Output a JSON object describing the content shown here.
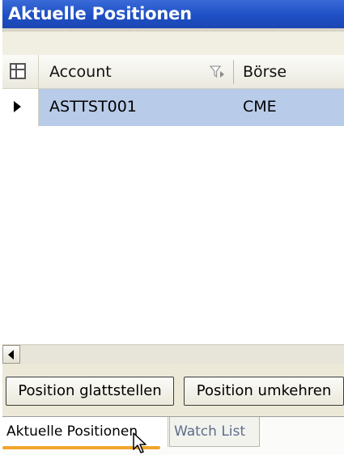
{
  "window": {
    "title": "Aktuelle Positionen"
  },
  "grid": {
    "columns": [
      {
        "label": "Account",
        "filter_icon": "filter-icon"
      },
      {
        "label": "Börse"
      }
    ],
    "rows": [
      {
        "account": "ASTTST001",
        "boerse": "CME",
        "selected": true
      }
    ]
  },
  "buttons": {
    "close_position": "Position glattstellen",
    "reverse_position": "Position umkehren"
  },
  "tabs": [
    {
      "label": "Aktuelle Positionen",
      "active": true
    },
    {
      "label": "Watch List",
      "active": false
    }
  ],
  "colors": {
    "titlebar": "#1e4fc4",
    "selected_row": "#b8cbe8",
    "active_tab_underline": "#f1a52b"
  }
}
